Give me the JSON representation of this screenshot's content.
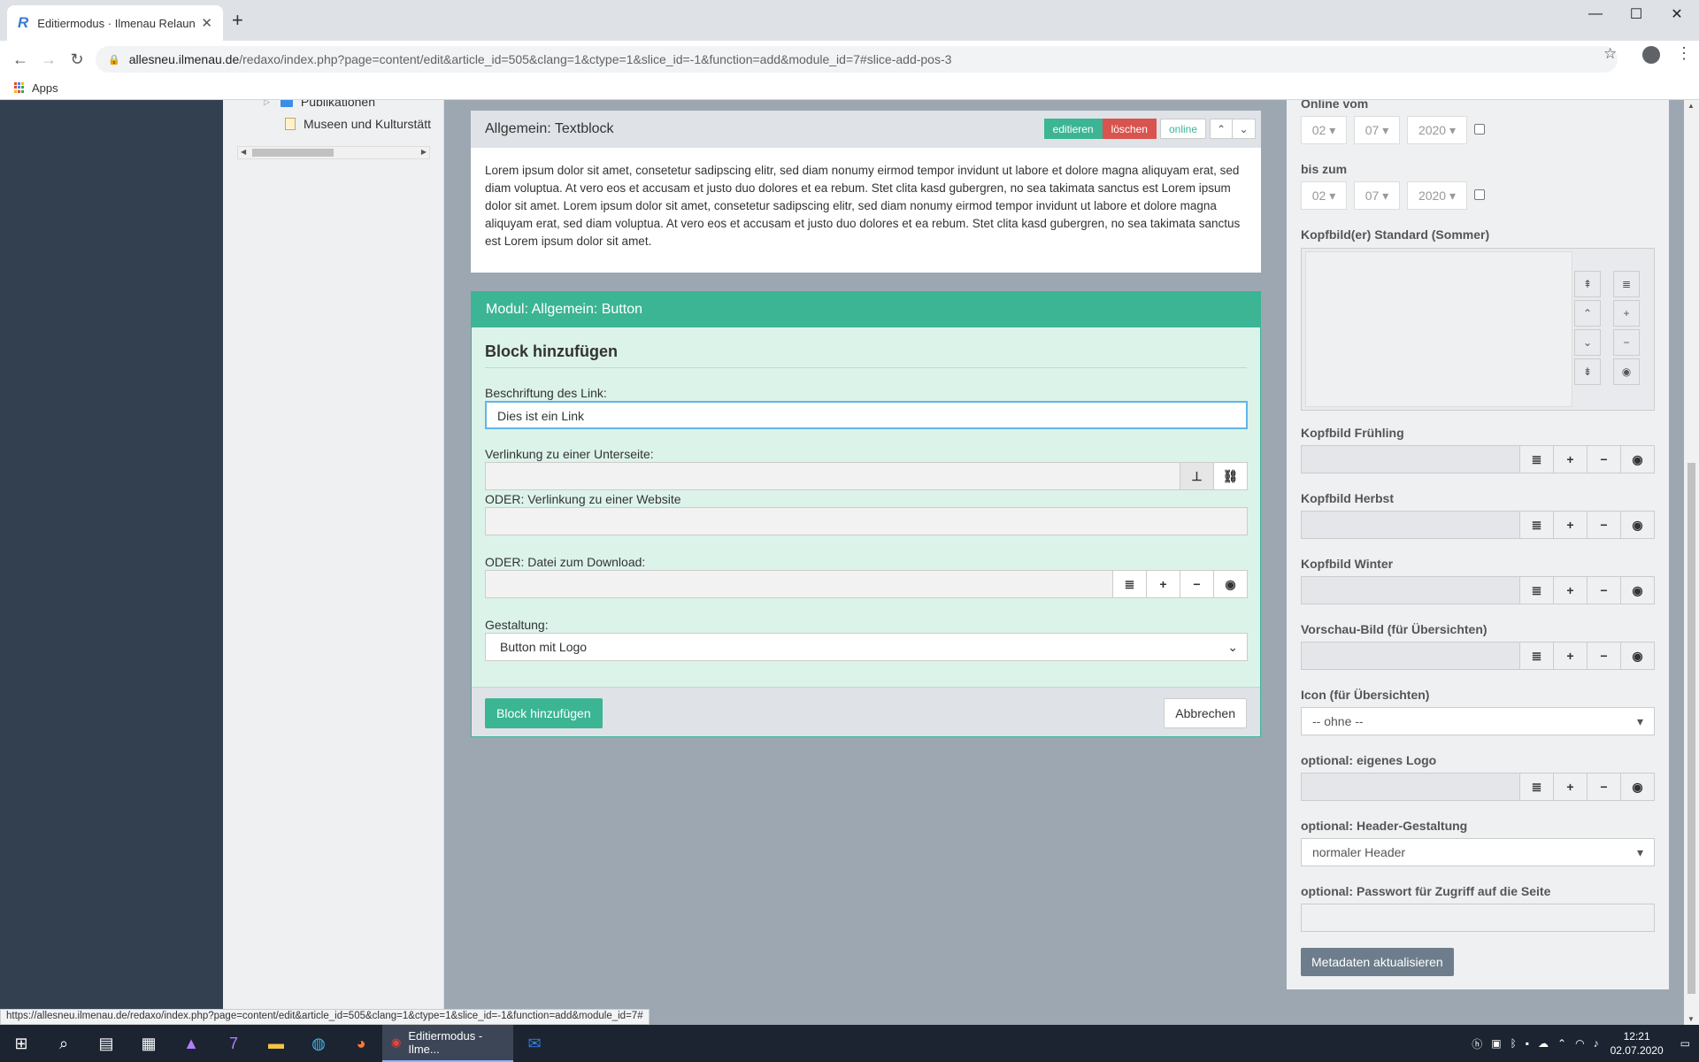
{
  "browser": {
    "tab_title": "Editiermodus · Ilmenau Relaunch",
    "tab_favicon": "R",
    "url_host": "allesneu.ilmenau.de",
    "url_path": "/redaxo/index.php?page=content/edit&article_id=505&clang=1&ctype=1&slice_id=-1&function=add&module_id=7#slice-add-pos-3",
    "bookmark_apps": "Apps",
    "status_url": "https://allesneu.ilmenau.de/redaxo/index.php?page=content/edit&article_id=505&clang=1&ctype=1&slice_id=-1&function=add&module_id=7#"
  },
  "tree": {
    "items": [
      {
        "label": "Publikationen",
        "type": "folder"
      },
      {
        "label": "Museen und Kulturstätt",
        "type": "document"
      }
    ]
  },
  "text_slice": {
    "title": "Allgemein: Textblock",
    "edit_label": "editieren",
    "delete_label": "löschen",
    "status_label": "online",
    "body": "Lorem ipsum dolor sit amet, consetetur sadipscing elitr, sed diam nonumy eirmod tempor invidunt ut labore et dolore magna aliquyam erat, sed diam voluptua. At vero eos et accusam et justo duo dolores et ea rebum. Stet clita kasd gubergren, no sea takimata sanctus est Lorem ipsum dolor sit amet. Lorem ipsum dolor sit amet, consetetur sadipscing elitr, sed diam nonumy eirmod tempor invidunt ut labore et dolore magna aliquyam erat, sed diam voluptua. At vero eos et accusam et justo duo dolores et ea rebum. Stet clita kasd gubergren, no sea takimata sanctus est Lorem ipsum dolor sit amet."
  },
  "module": {
    "header": "Modul: Allgemein: Button",
    "block_title": "Block hinzufügen",
    "link_label_caption": "Beschriftung des Link:",
    "link_label_value": "Dies ist ein Link",
    "subpage_caption": "Verlinkung zu einer Unterseite:",
    "website_caption": "ODER: Verlinkung zu einer Website",
    "download_caption": "ODER: Datei zum Download:",
    "design_caption": "Gestaltung:",
    "design_value": "Button mit Logo",
    "submit_label": "Block hinzufügen",
    "cancel_label": "Abbrechen"
  },
  "meta": {
    "online_from_label": "Online vom",
    "online_from": {
      "day": "02",
      "month": "07",
      "year": "2020"
    },
    "until_label": "bis zum",
    "until": {
      "day": "02",
      "month": "07",
      "year": "2020"
    },
    "header_default_label": "Kopfbild(er) Standard (Sommer)",
    "header_spring_label": "Kopfbild Frühling",
    "header_autumn_label": "Kopfbild Herbst",
    "header_winter_label": "Kopfbild Winter",
    "preview_label": "Vorschau-Bild (für Übersichten)",
    "icon_label": "Icon (für Übersichten)",
    "icon_value": "-- ohne --",
    "logo_label": "optional: eigenes Logo",
    "header_design_label": "optional: Header-Gestaltung",
    "header_design_value": "normaler Header",
    "password_label": "optional: Passwort für Zugriff auf die Seite",
    "update_button": "Metadaten aktualisieren"
  },
  "taskbar": {
    "active_window": "Editiermodus - Ilme...",
    "time": "12:21",
    "date": "02.07.2020"
  },
  "colors": {
    "accent_green": "#3bb594",
    "danger_red": "#d9534f",
    "sidebar_dark": "#324050"
  }
}
